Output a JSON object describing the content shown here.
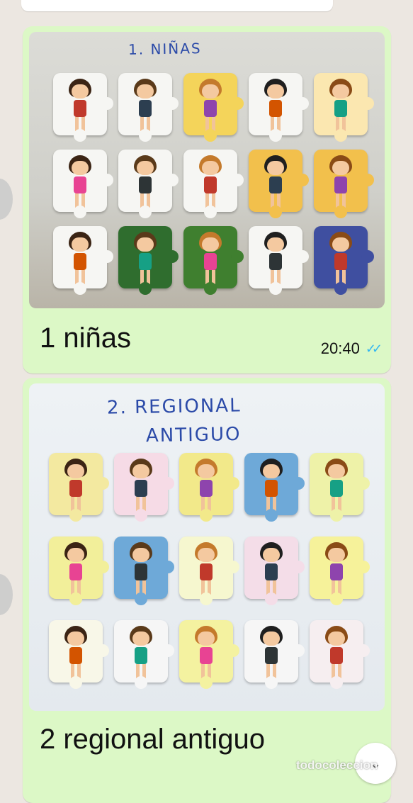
{
  "messages": [
    {
      "caption": "1 niñas",
      "time": "20:40",
      "photo_heading": "1. NIÑAS",
      "tile_colors": [
        "#f6f6f3",
        "#f6f6f3",
        "#f4d45a",
        "#f6f6f3",
        "#fbe7b0",
        "#f6f6f3",
        "#f6f6f3",
        "#f6f6f3",
        "#f2c04c",
        "#f2c04c",
        "#f6f6f3",
        "#2f6d2e",
        "#3f7f2f",
        "#f6f6f3",
        "#3f4fa0"
      ]
    },
    {
      "caption": "2 regional antiguo",
      "photo_heading_line1": "2. REGIONAL",
      "photo_heading_line2": "ANTIGUO",
      "tile_colors": [
        "#f3e9a0",
        "#f6dbe6",
        "#f2e98a",
        "#6ea9d8",
        "#eef2a8",
        "#f2ef9a",
        "#6ea9d8",
        "#f6f7cf",
        "#f4dde8",
        "#f6f29a",
        "#f8f7e8",
        "#f6f6f6",
        "#f4f2a0",
        "#f6f6f6",
        "#f6eef0"
      ]
    }
  ],
  "watermark": "todocoleccion",
  "icons": {
    "read_receipt": "double-check-icon",
    "scroll_down": "chevron-down-icon"
  },
  "colors": {
    "bubble": "#dcf8c6",
    "background": "#ece7e1",
    "ticks": "#34b7f1"
  }
}
